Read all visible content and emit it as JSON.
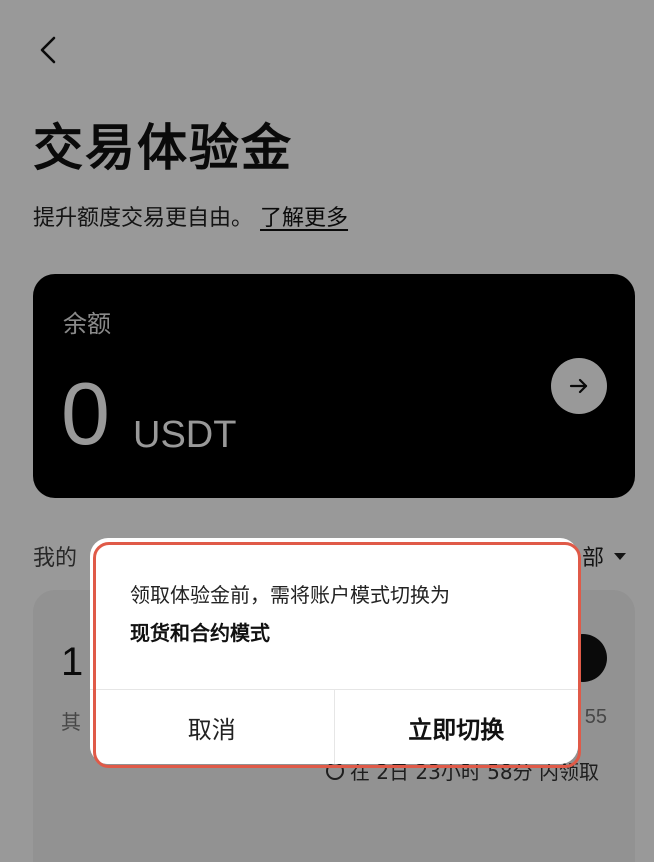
{
  "header": {
    "back_icon": "chevron-left-icon",
    "title": "交易体验金",
    "subtitle": "提升额度交易更自由。",
    "learn_more": "了解更多"
  },
  "balance": {
    "label": "余额",
    "amount": "0",
    "unit": "USDT",
    "arrow_icon": "arrow-right-icon"
  },
  "my_section": {
    "label": "我的",
    "filter_label": "部"
  },
  "voucher": {
    "amount": "1",
    "other_label": "其",
    "number": "55",
    "expiry": "在 2日 23小时 58分 内领取"
  },
  "dialog": {
    "message": "领取体验金前，需将账户模式切换为",
    "emphasis": "现货和合约模式",
    "cancel_label": "取消",
    "confirm_label": "立即切换"
  },
  "colors": {
    "highlight_border": "#e05a48",
    "card_bg": "#000000"
  }
}
